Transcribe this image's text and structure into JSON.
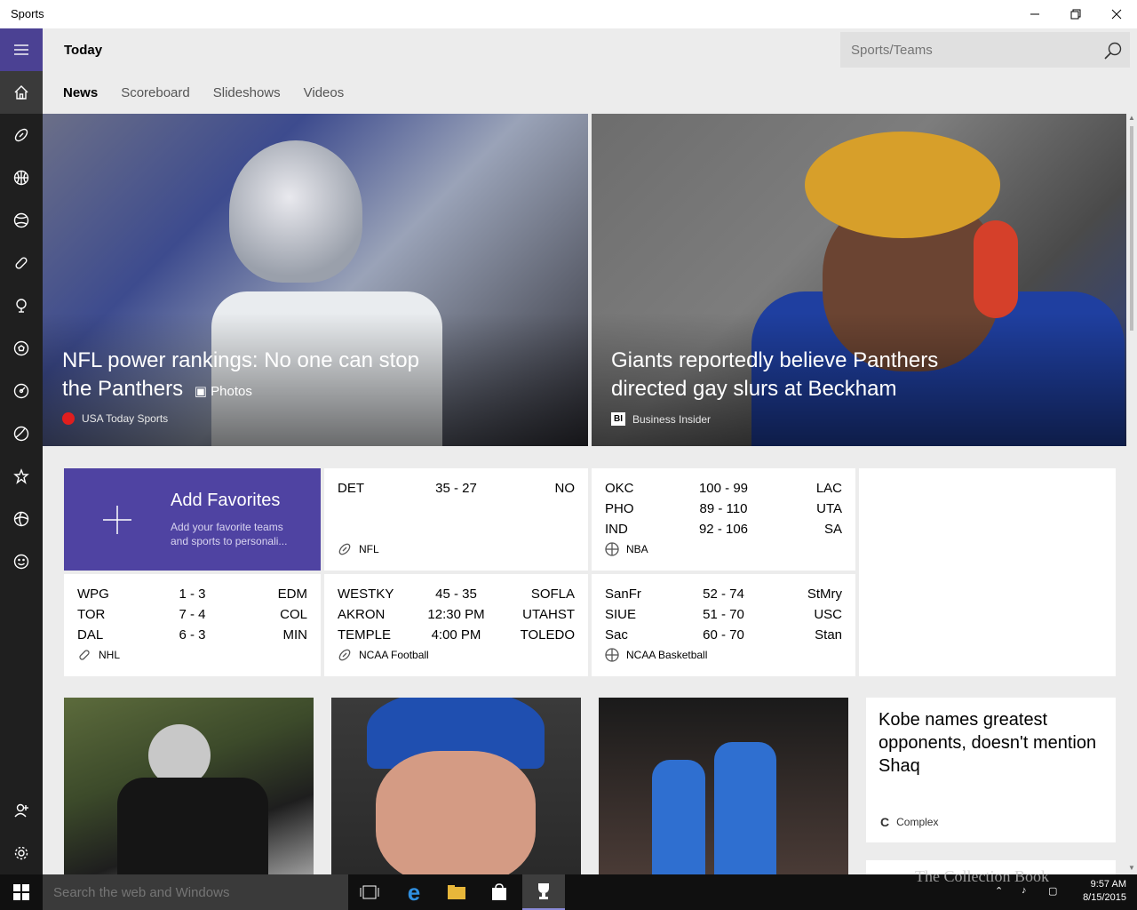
{
  "window": {
    "title": "Sports"
  },
  "header": {
    "page_title": "Today",
    "search_placeholder": "Sports/Teams",
    "tabs": [
      {
        "label": "News",
        "active": true
      },
      {
        "label": "Scoreboard",
        "active": false
      },
      {
        "label": "Slideshows",
        "active": false
      },
      {
        "label": "Videos",
        "active": false
      }
    ]
  },
  "nav_rail": {
    "items": [
      "menu-icon",
      "home-icon",
      "football-icon",
      "basketball-icon",
      "baseball-icon",
      "hockey-icon",
      "golf-icon",
      "soccer-icon",
      "racing-icon",
      "tennis-icon",
      "favorites-icon",
      "sports-icon",
      "fun-icon"
    ],
    "bottom": [
      "add-person-icon",
      "settings-icon"
    ]
  },
  "hero": [
    {
      "headline": "NFL power rankings: No one can stop the Panthers",
      "tag": "Photos",
      "source": "USA Today Sports"
    },
    {
      "headline": "Giants reportedly believe Panthers directed gay slurs at Beckham",
      "source": "Business Insider",
      "source_logo": "BI"
    }
  ],
  "favorites": {
    "title": "Add Favorites",
    "description": "Add your favorite teams and sports to personali..."
  },
  "scores": {
    "nfl": {
      "league": "NFL",
      "rows": [
        {
          "a": "DET",
          "r": "35  -  27",
          "b": "NO"
        }
      ]
    },
    "nba": {
      "league": "NBA",
      "rows": [
        {
          "a": "OKC",
          "r": "100  -  99",
          "b": "LAC"
        },
        {
          "a": "PHO",
          "r": "89  -  110",
          "b": "UTA"
        },
        {
          "a": "IND",
          "r": "92  -  106",
          "b": "SA"
        }
      ]
    },
    "nhl": {
      "league": "NHL",
      "rows": [
        {
          "a": "WPG",
          "r": "1  -  3",
          "b": "EDM"
        },
        {
          "a": "TOR",
          "r": "7  -  4",
          "b": "COL"
        },
        {
          "a": "DAL",
          "r": "6  -  3",
          "b": "MIN"
        }
      ]
    },
    "ncaaf": {
      "league": "NCAA Football",
      "rows": [
        {
          "a": "WESTKY",
          "r": "45  -  35",
          "b": "SOFLA"
        },
        {
          "a": "AKRON",
          "r": "12:30 PM",
          "b": "UTAHST"
        },
        {
          "a": "TEMPLE",
          "r": "4:00 PM",
          "b": "TOLEDO"
        }
      ]
    },
    "ncaab": {
      "league": "NCAA Basketball",
      "rows": [
        {
          "a": "SanFr",
          "r": "52  -  74",
          "b": "StMry"
        },
        {
          "a": "SIUE",
          "r": "51  -  70",
          "b": "USC"
        },
        {
          "a": "Sac",
          "r": "60  -  70",
          "b": "Stan"
        }
      ]
    }
  },
  "news_card": {
    "title": "Kobe names greatest opponents, doesn't mention Shaq",
    "source": "Complex"
  },
  "taskbar": {
    "search_placeholder": "Search the web and Windows",
    "time": "9:57 AM",
    "date": "8/15/2015"
  },
  "watermark": "The Collection Book",
  "colors": {
    "accent": "#4f43a2",
    "rail": "#1f1f1f",
    "page_bg": "#ececec"
  }
}
